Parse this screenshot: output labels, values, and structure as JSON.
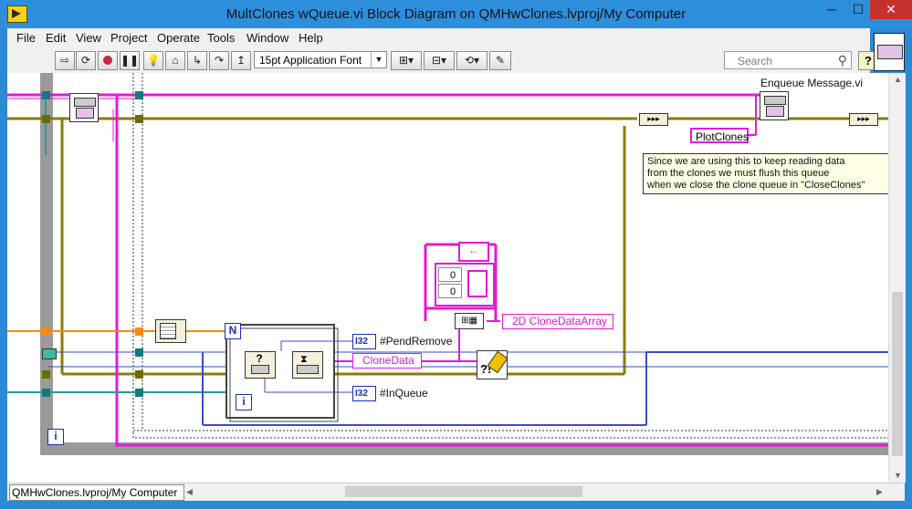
{
  "window": {
    "title": "MultClones wQueue.vi Block Diagram on QMHwClones.lvproj/My Computer",
    "controls": {
      "minimize": "─",
      "maximize": "☐",
      "close": "✕"
    }
  },
  "menu": [
    "File",
    "Edit",
    "View",
    "Project",
    "Operate",
    "Tools",
    "Window",
    "Help"
  ],
  "toolbar": {
    "font_select": "15pt Application Font",
    "search_placeholder": "Search",
    "help_label": "?"
  },
  "diagram": {
    "enqueue_label": "Enqueue Message.vi",
    "plotclones": "PlotClones",
    "comment": [
      "Since we are using this to keep reading data",
      "from the clones we must flush this queue",
      "when we close the clone queue in \"CloseClones\""
    ],
    "pendremove": "#PendRemove",
    "clonedata": "CloneData",
    "inqueue": "#InQueue",
    "array2d": "2D CloneDataArray",
    "i32": "I32",
    "array_index0": "0",
    "array_index1": "0",
    "n_label": "N",
    "i_label": "i",
    "question": "?"
  },
  "colors": {
    "pink_wire": "#e41ad9",
    "yellow_wire": "#8b7d00",
    "orange_wire": "#ff8c00",
    "teal_wire": "#2b9a9a",
    "blue_wire": "#3a4bd1"
  },
  "status": {
    "path": "QMHwClones.lvproj/My Computer"
  }
}
